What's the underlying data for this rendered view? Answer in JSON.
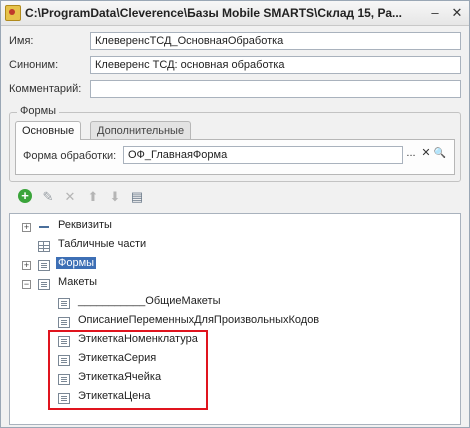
{
  "window": {
    "title": "C:\\ProgramData\\Cleverence\\Базы Mobile SMARTS\\Склад 15, Ра...",
    "minimize_glyph": "–",
    "close_glyph": "✕"
  },
  "fields": {
    "name_label": "Имя:",
    "name_value": "КлеверенсТСД_ОсновнаяОбработка",
    "synonym_label": "Синоним:",
    "synonym_value": "Клеверенс ТСД: основная обработка",
    "comment_label": "Комментарий:",
    "comment_value": ""
  },
  "forms_group": {
    "legend": "Формы",
    "tabs": [
      "Основные",
      "Дополнительные"
    ],
    "processing_form_label": "Форма обработки:",
    "processing_form_value": "ОФ_ГлавнаяФорма",
    "ellipsis_glyph": "...",
    "clear_glyph": "✕",
    "open_glyph": "🔍"
  },
  "toolbar": {
    "add_icon": "+",
    "edit_icon": "✎",
    "delete_icon": "✕",
    "up_icon": "⬆",
    "down_icon": "⬇",
    "sort_icon": "▤"
  },
  "tree": {
    "expand_glyph": "+",
    "collapse_glyph": "−",
    "items": [
      "Реквизиты",
      "Табличные части",
      "Формы",
      "Макеты",
      "___________ОбщиеМакеты",
      "ОписаниеПеременныхДляПроизвольныхКодов",
      "ЭтикеткаНоменклатура",
      "ЭтикеткаСерия",
      "ЭтикеткаЯчейка",
      "ЭтикеткаЦена"
    ]
  },
  "colors": {
    "selection": "#3d6fb5",
    "highlight_border": "#e0141e",
    "add_icon_green": "#3aa43a"
  }
}
